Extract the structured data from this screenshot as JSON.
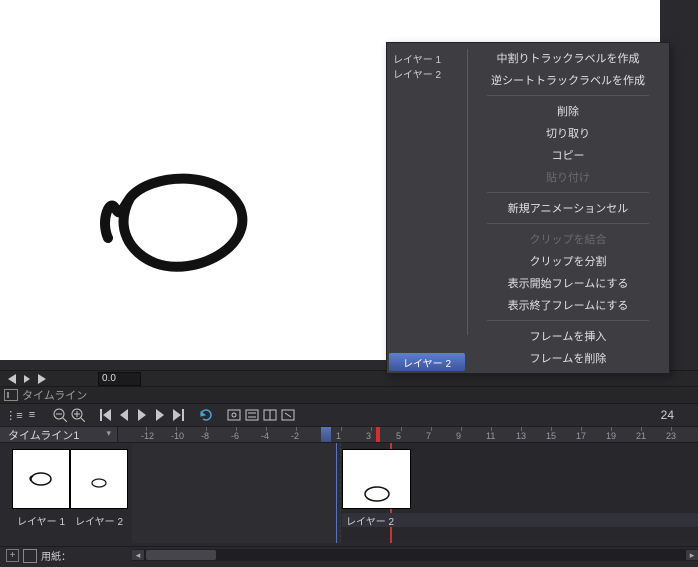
{
  "canvas": {
    "bg": "#ffffff"
  },
  "nav": {
    "frame_value": "0.0"
  },
  "timeline_title": "タイムライン",
  "timeline_tab": "タイムライン1",
  "frame_number_display": "24",
  "ruler_ticks": [
    "-12",
    "-10",
    "-8",
    "-6",
    "-4",
    "-2",
    "0",
    "1",
    "3",
    "5",
    "7",
    "9",
    "11",
    "13",
    "15",
    "17",
    "19",
    "21",
    "23"
  ],
  "track": {
    "layer_labels": [
      "レイヤー 1",
      "レイヤー 2"
    ],
    "clip_label": "レイヤー 2"
  },
  "bottom": {
    "paper_label": "用紙："
  },
  "context_menu": {
    "left_items": [
      "レイヤー 1",
      "レイヤー 2"
    ],
    "footer_selected": "レイヤー 2",
    "items": [
      {
        "label": "中割りトラックラベルを作成",
        "enabled": true
      },
      {
        "label": "逆シートトラックラベルを作成",
        "enabled": true
      },
      "sep",
      {
        "label": "削除",
        "enabled": true
      },
      {
        "label": "切り取り",
        "enabled": true
      },
      {
        "label": "コピー",
        "enabled": true
      },
      {
        "label": "貼り付け",
        "enabled": false
      },
      "sep",
      {
        "label": "新規アニメーションセル",
        "enabled": true
      },
      "sep",
      {
        "label": "クリップを結合",
        "enabled": false
      },
      {
        "label": "クリップを分割",
        "enabled": true
      },
      {
        "label": "表示開始フレームにする",
        "enabled": true
      },
      {
        "label": "表示終了フレームにする",
        "enabled": true
      },
      "sep",
      {
        "label": "フレームを挿入",
        "enabled": true
      },
      {
        "label": "フレームを削除",
        "enabled": true
      }
    ]
  }
}
